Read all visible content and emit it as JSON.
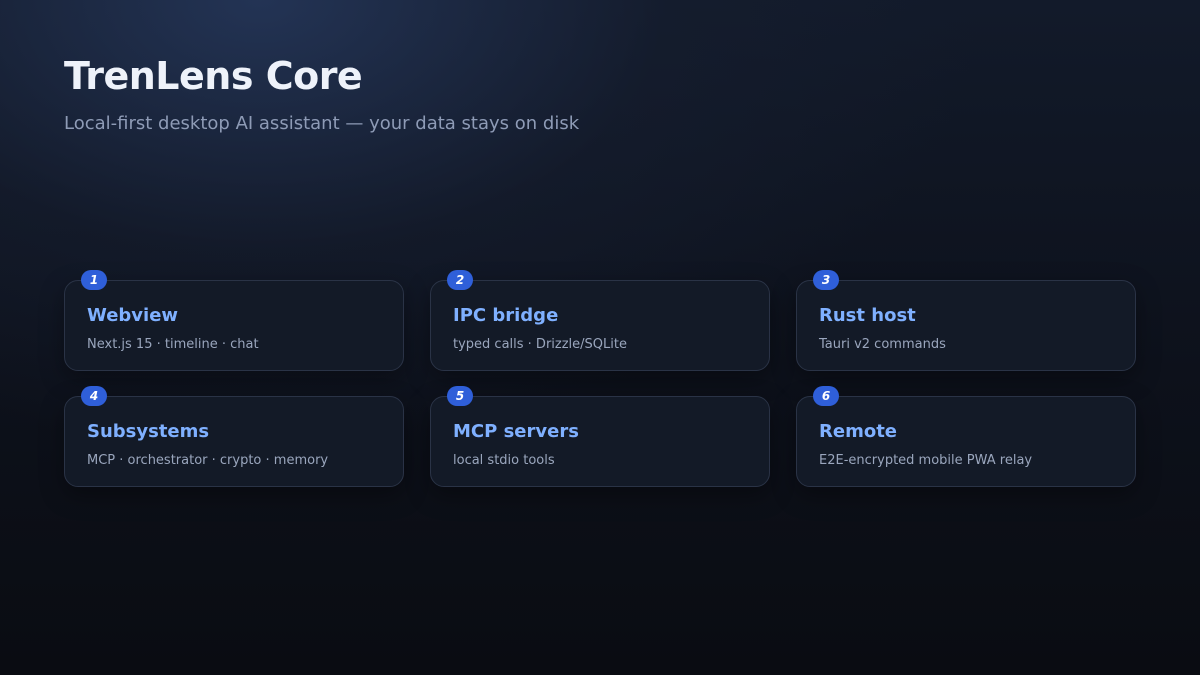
{
  "header": {
    "title": "TrenLens Core",
    "subtitle": "Local-first desktop AI assistant — your data stays on disk"
  },
  "cards": [
    {
      "number": "1",
      "title": "Webview",
      "description": "Next.js 15 · timeline · chat"
    },
    {
      "number": "2",
      "title": "IPC bridge",
      "description": "typed calls · Drizzle/SQLite"
    },
    {
      "number": "3",
      "title": "Rust host",
      "description": "Tauri v2 commands"
    },
    {
      "number": "4",
      "title": "Subsystems",
      "description": "MCP · orchestrator · crypto · memory"
    },
    {
      "number": "5",
      "title": "MCP servers",
      "description": "local stdio tools"
    },
    {
      "number": "6",
      "title": "Remote",
      "description": "E2E-encrypted mobile PWA relay"
    }
  ],
  "colors": {
    "accent": "#7fb0ff",
    "badge": "#2f5fd9",
    "card_background": "#131a27",
    "card_border": "#2a3346"
  }
}
